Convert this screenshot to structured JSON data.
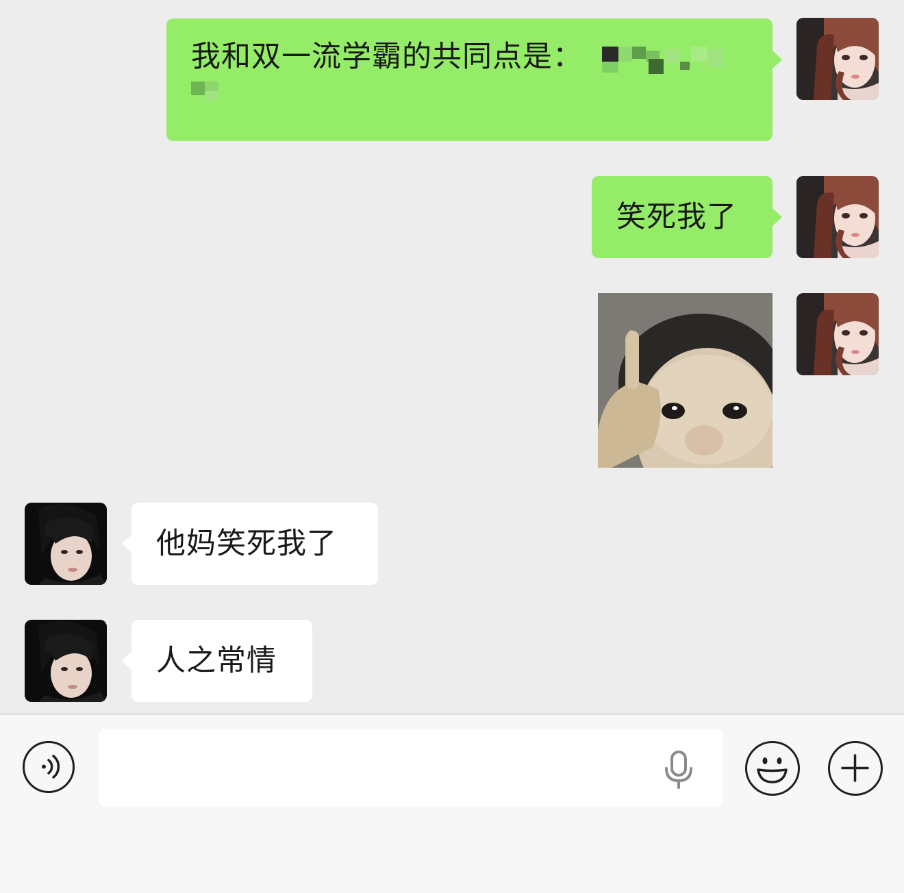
{
  "messages": [
    {
      "sender": "me",
      "type": "text",
      "text": "我和双一流学霸的共同点是："
    },
    {
      "sender": "me",
      "type": "text",
      "text": "笑死我了"
    },
    {
      "sender": "me",
      "type": "sticker",
      "description": "baby-pointing-finger-sticker"
    },
    {
      "sender": "other",
      "type": "text",
      "text": "他妈笑死我了"
    },
    {
      "sender": "other",
      "type": "text",
      "text": "人之常情"
    }
  ],
  "input_bar": {
    "placeholder": "",
    "voice_icon": "voice-mode-icon",
    "mic_icon": "microphone-icon",
    "emoji_icon": "emoji-icon",
    "more_icon": "plus-icon"
  },
  "colors": {
    "background": "#ededed",
    "my_bubble": "#95ec69",
    "their_bubble": "#ffffff",
    "input_bar": "#f7f7f7"
  }
}
